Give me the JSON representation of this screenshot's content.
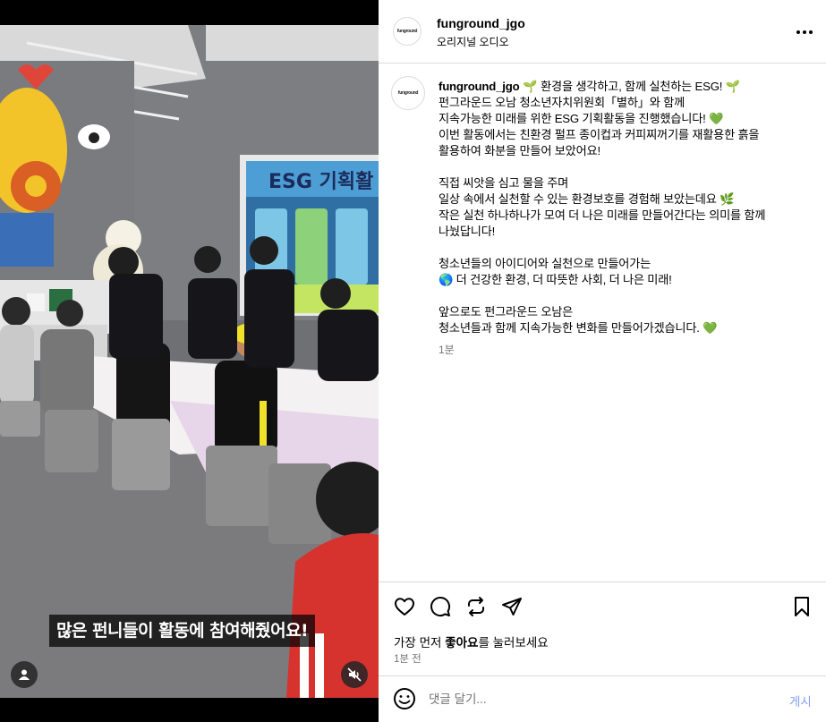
{
  "header": {
    "username": "funground_jgo",
    "audio": "오리지널 오디오",
    "avatar_logo": "funground"
  },
  "video": {
    "subtitle": "많은 펀니들이 활동에 참여해줬어요!",
    "banner_text": "ESG 기획활"
  },
  "caption": {
    "username": "funground_jgo",
    "lines": [
      "🌱 환경을 생각하고, 함께 실천하는 ESG! 🌱",
      "펀그라운드 오남 청소년자치위원회「별하」와 함께",
      "지속가능한 미래를 위한 ESG 기획활동을 진행했습니다! 💚",
      "이번 활동에서는 친환경 펄프 종이컵과 커피찌꺼기를 재활용한 흙을",
      "활용하여 화분을 만들어 보았어요!",
      "",
      "직접 씨앗을 심고 물을 주며",
      "일상 속에서 실천할 수 있는 환경보호를 경험해 보았는데요 🌿",
      "작은 실천 하나하나가 모여 더 나은 미래를 만들어간다는 의미를 함께",
      "나눴답니다!",
      "",
      "청소년들의 아이디어와 실천으로 만들어가는",
      "🌎 더 건강한 환경, 더 따뜻한 사회, 더 나은 미래!",
      "",
      "앞으로도 펀그라운드 오남은",
      "청소년들과 함께 지속가능한 변화를 만들어가겠습니다. 💚"
    ],
    "time": "1분"
  },
  "actions": {
    "likes_prefix": "가장 먼저 ",
    "likes_bold": "좋아요",
    "likes_suffix": "를 눌러보세요",
    "time_ago": "1분 전"
  },
  "comment": {
    "placeholder": "댓글 달기...",
    "post_label": "게시"
  },
  "icons": {
    "like": "heart-icon",
    "comment": "comment-icon",
    "share": "repost-icon",
    "send": "send-icon",
    "save": "bookmark-icon",
    "more": "more-icon",
    "emoji": "emoji-icon",
    "mute": "muted-speaker-icon",
    "tagged": "user-icon"
  },
  "colors": {
    "post_button": "#85a1f3",
    "muted_text": "#737373",
    "divider": "#dbdbdb"
  }
}
